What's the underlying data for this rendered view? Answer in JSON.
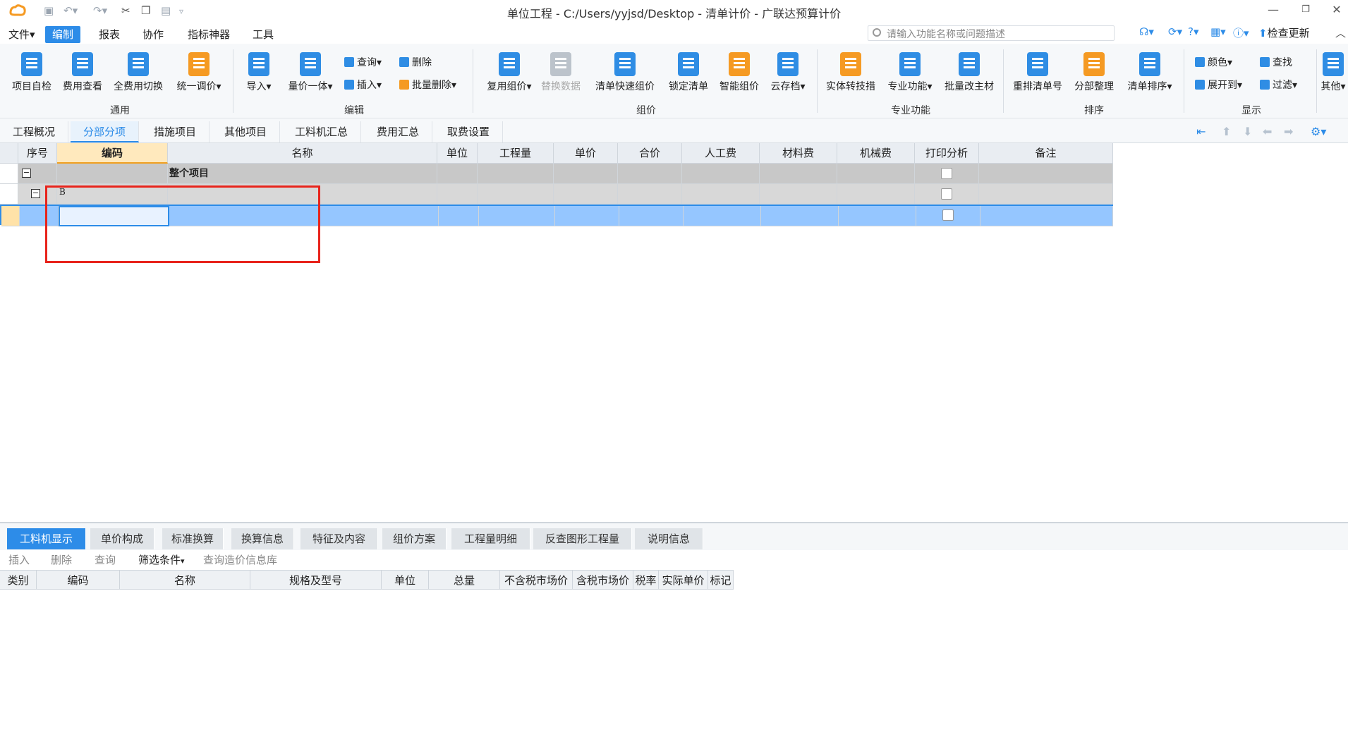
{
  "window": {
    "title": "单位工程 - C:/Users/yyjsd/Desktop - 清单计价 - 广联达预算计价",
    "controls": [
      "—",
      "❐",
      "✕"
    ]
  },
  "menubar": {
    "items": [
      "文件",
      "编制",
      "报表",
      "协作",
      "指标神器",
      "工具"
    ],
    "active": "编制",
    "search_placeholder": "请输入功能名称或问题描述",
    "check_update": "检查更新"
  },
  "ribbon": {
    "groups": [
      {
        "label": "通用",
        "buttons": [
          "项目自检",
          "费用查看",
          "全费用切换",
          "统一调价"
        ]
      },
      {
        "label": "编辑",
        "buttons": [
          "导入",
          "量价一体",
          "查询",
          "插入",
          "删除",
          "批量删除"
        ]
      },
      {
        "label": "组价",
        "buttons": [
          "复用组价",
          "替换数据",
          "清单快速组价",
          "锁定清单",
          "智能组价",
          "云存档"
        ]
      },
      {
        "label": "专业功能",
        "buttons": [
          "实体转技措",
          "专业功能",
          "批量改主材"
        ]
      },
      {
        "label": "排序",
        "buttons": [
          "重排清单号",
          "分部整理",
          "清单排序"
        ]
      },
      {
        "label": "显示",
        "buttons": [
          "颜色",
          "查找",
          "展开到",
          "过滤",
          "其他"
        ]
      }
    ]
  },
  "tabs": {
    "items": [
      "工程概况",
      "分部分项",
      "措施项目",
      "其他项目",
      "工料机汇总",
      "费用汇总",
      "取费设置"
    ],
    "active": "分部分项"
  },
  "grid": {
    "columns": [
      "序号",
      "编码",
      "名称",
      "单位",
      "工程量",
      "单价",
      "合价",
      "人工费",
      "材料费",
      "机械费",
      "打印分析",
      "备注"
    ],
    "selected_column": "编码",
    "rows": [
      {
        "code": "",
        "name": "整个项目"
      },
      {
        "code": "B",
        "name": ""
      },
      {
        "code": "",
        "name": ""
      }
    ]
  },
  "bottom": {
    "tabs": [
      "工料机显示",
      "单价构成",
      "标准换算",
      "换算信息",
      "特征及内容",
      "组价方案",
      "工程量明细",
      "反查图形工程量",
      "说明信息"
    ],
    "active": "工料机显示",
    "toolbar": [
      "插入",
      "删除",
      "查询",
      "筛选条件",
      "查询造价信息库"
    ],
    "columns": [
      "类别",
      "编码",
      "名称",
      "规格及型号",
      "单位",
      "总量",
      "不含税市场价",
      "含税市场价",
      "税率",
      "实际单价",
      "标记"
    ]
  },
  "colors": {
    "accent": "#2d8ce8",
    "highlight_row": "#95c6ff",
    "annotation": "#e8241c"
  }
}
